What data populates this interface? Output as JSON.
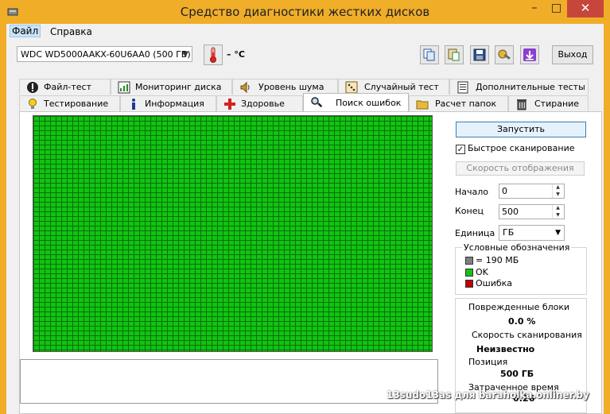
{
  "window": {
    "title": "Средство диагностики жестких дисков",
    "minimize": "–",
    "maximize": "□",
    "close": "✕"
  },
  "menu": {
    "file": "Файл",
    "help": "Справка"
  },
  "toolbar": {
    "disk": "WDC WD5000AAKX-60U6AA0 (500 ГБ)",
    "temperature": "– °C",
    "exit": "Выход",
    "icons": [
      "copy-icon",
      "paste-icon",
      "save-icon",
      "tools-icon",
      "download-icon"
    ]
  },
  "tabs": {
    "row1": [
      "Файл-тест",
      "Мониторинг диска",
      "Уровень шума",
      "Случайный тест",
      "Дополнительные тесты"
    ],
    "row2": [
      "Тестирование",
      "Информация",
      "Здоровье",
      "Поиск ошибок",
      "Расчет папок",
      "Стирание"
    ],
    "active": "Поиск ошибок"
  },
  "scan": {
    "start": "Запустить",
    "quick_scan": "Быстрое сканирование",
    "quick_scan_checked": true,
    "display_speed": "Скорость отображения",
    "start_label": "Начало",
    "start_value": "0",
    "end_label": "Конец",
    "end_value": "500",
    "unit_label": "Единица",
    "unit_value": "ГБ"
  },
  "legend": {
    "title": "Условные обозначения",
    "block": "= 190 МБ",
    "ok": "OK",
    "error": "Ошибка",
    "colors": {
      "block": "#808080",
      "ok": "#11c411",
      "error": "#c00000"
    }
  },
  "stats": {
    "damaged_label": "Поврежденные блоки",
    "damaged_value": "0.0 %",
    "speed_label": "Скорость сканирования",
    "speed_value": "Неизвестно",
    "position_label": "Позиция",
    "position_value": "500 ГБ",
    "elapsed_label": "Затраченное время",
    "elapsed_value": "0:26"
  },
  "watermark": "13sudo13as для baraholka.onliner.by"
}
